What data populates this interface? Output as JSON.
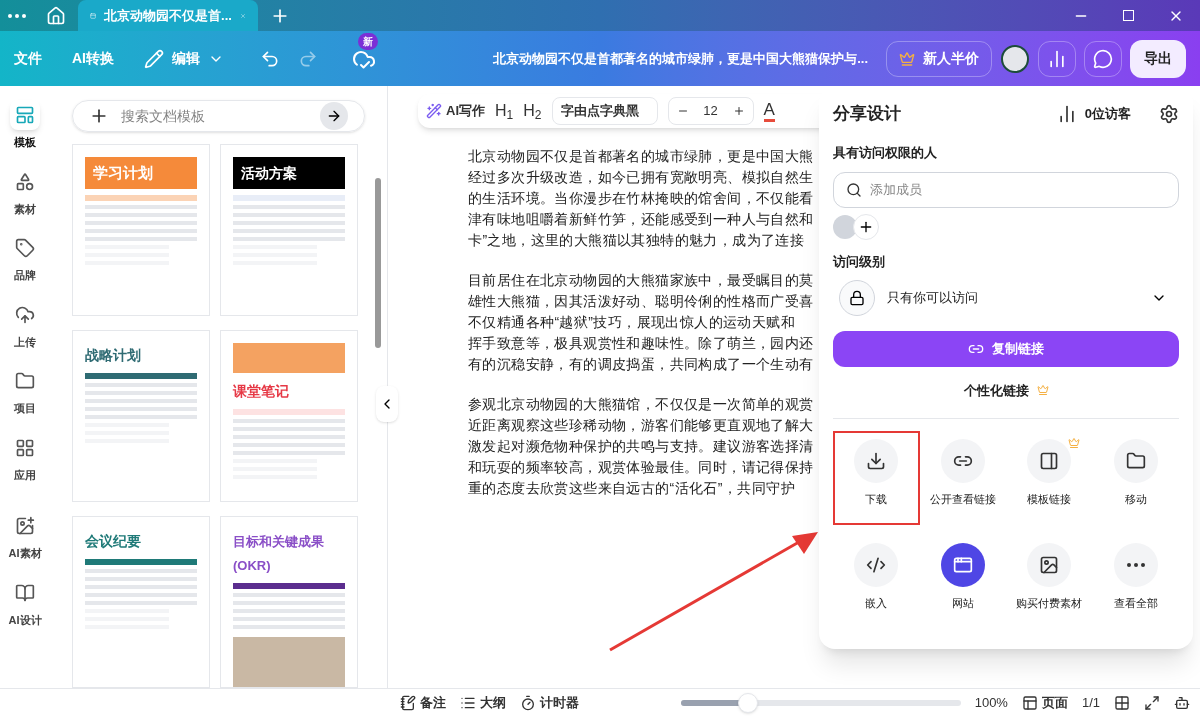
{
  "tab_bar": {
    "tabs": [
      {
        "label": "北京动物园不仅是首...",
        "selected": true
      }
    ]
  },
  "toolbar": {
    "menu": [
      "文件",
      "AI转换"
    ],
    "edit": "编辑",
    "new_badge": "新",
    "doc_title": "北京动物园不仅是首都著名的城市绿肺，更是中国大熊猫保护与...",
    "promo": "新人半价",
    "export": "导出"
  },
  "sidebar": {
    "items": [
      {
        "label": "模板",
        "selected": true
      },
      {
        "label": "素材",
        "selected": false
      },
      {
        "label": "品牌",
        "selected": false
      },
      {
        "label": "上传",
        "selected": false
      },
      {
        "label": "项目",
        "selected": false
      },
      {
        "label": "应用",
        "selected": false
      },
      {
        "label": "AI素材",
        "selected": false
      },
      {
        "label": "AI设计",
        "selected": false
      }
    ]
  },
  "template_panel": {
    "search": {
      "placeholder": "搜索文档模板"
    },
    "templates": [
      {
        "title": "学习计划"
      },
      {
        "title": "活动方案"
      },
      {
        "title": "战略计划"
      },
      {
        "title": "课堂笔记"
      },
      {
        "title": "会议纪要"
      },
      {
        "title": "目标和关键成果(OKR)"
      }
    ]
  },
  "format_bar": {
    "ai_write": "AI写作",
    "h1": "H$_{1}$",
    "h2": "H$_{2}$",
    "font": "字由点字典黑",
    "size": "12",
    "text_color": "A"
  },
  "document": {
    "paragraphs": [
      [
        "北京动物园不仅是首都著名的城市绿肺，更是中国大熊",
        "经过多次升级改造，如今已拥有宽敞明亮、模拟自然生",
        "的生活环境。当你漫步在竹林掩映的馆舍间，不仅能看",
        "津有味地咀嚼着新鲜竹笋，还能感受到一种人与自然和",
        "卡”之地，这里的大熊猫以其独特的魅力，成为了连接"
      ],
      [
        "目前居住在北京动物园的大熊猫家族中，最受瞩目的莫",
        "雄性大熊猫，因其活泼好动、聪明伶俐的性格而广受喜",
        "不仅精通各种“越狱”技巧，展现出惊人的运动天赋和",
        "挥手致意等，极具观赏性和趣味性。除了萌兰，园内还",
        "有的沉稳安静，有的调皮捣蛋，共同构成了一个生动有"
      ],
      [
        "参观北京动物园的大熊猫馆，不仅仅是一次简单的观赏",
        "近距离观察这些珍稀动物，游客们能够更直观地了解大",
        "激发起对濒危物种保护的共鸣与支持。建议游客选择清",
        "和玩耍的频率较高，观赏体验最佳。同时，请记得保持",
        "重的态度去欣赏这些来自远古的“活化石”，共同守护"
      ]
    ]
  },
  "share_panel": {
    "title": "分享设计",
    "visitors": "0位访客",
    "people_heading": "具有访问权限的人",
    "member_search": {
      "placeholder": "添加成员"
    },
    "access_heading": "访问级别",
    "access_value": "只有你可以访问",
    "copy_link": "复制链接",
    "custom_link": "个性化链接",
    "actions": [
      {
        "label": "下载",
        "highlighted": true,
        "premium": false,
        "selected": false
      },
      {
        "label": "公开查看链接",
        "highlighted": false,
        "premium": false,
        "selected": false
      },
      {
        "label": "模板链接",
        "highlighted": false,
        "premium": true,
        "selected": false
      },
      {
        "label": "移动",
        "highlighted": false,
        "premium": false,
        "selected": false
      },
      {
        "label": "嵌入",
        "highlighted": false,
        "premium": false,
        "selected": false
      },
      {
        "label": "网站",
        "highlighted": false,
        "premium": false,
        "selected": true
      },
      {
        "label": "购买付费素材",
        "highlighted": false,
        "premium": false,
        "selected": false
      },
      {
        "label": "查看全部",
        "highlighted": false,
        "premium": false,
        "selected": false
      }
    ]
  },
  "status_bar": {
    "notes": "备注",
    "outline": "大纲",
    "timer": "计时器",
    "zoom": {
      "level": 0.24,
      "reading": "100%"
    },
    "page_view": "页面",
    "page_count": "1/1"
  }
}
